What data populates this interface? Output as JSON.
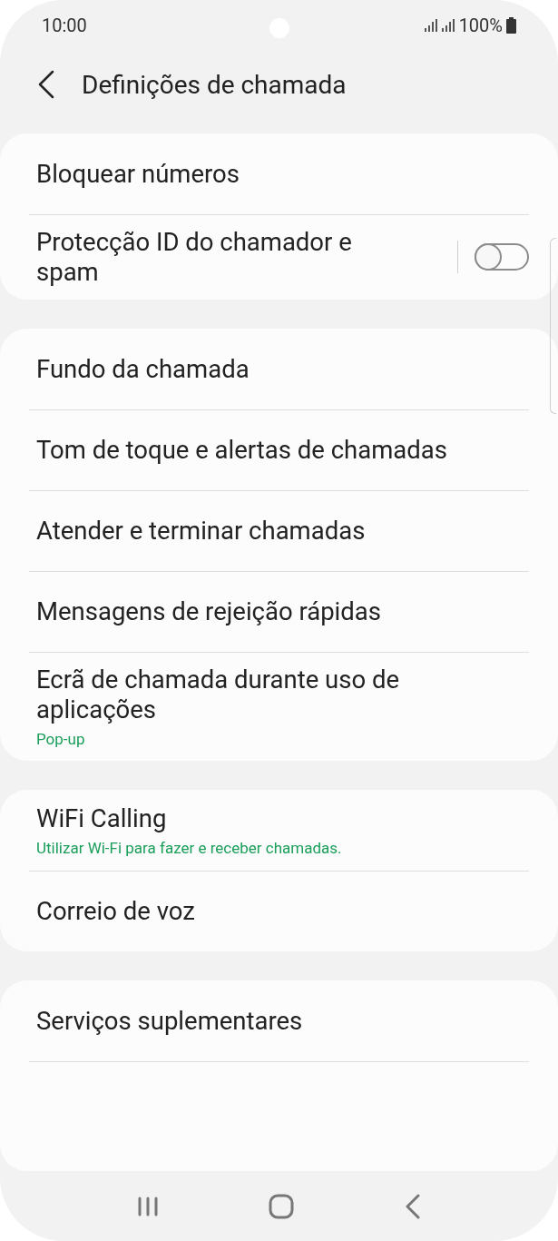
{
  "status_bar": {
    "time": "10:00",
    "battery": "100%"
  },
  "header": {
    "title": "Definições de chamada"
  },
  "sections": [
    {
      "items": [
        {
          "kind": "link",
          "label": "Bloquear números"
        },
        {
          "kind": "toggle",
          "label": "Protecção ID do chamador e spam",
          "on": false
        }
      ]
    },
    {
      "items": [
        {
          "kind": "link",
          "label": "Fundo da chamada"
        },
        {
          "kind": "link",
          "label": "Tom de toque e alertas de chamadas"
        },
        {
          "kind": "link",
          "label": "Atender e terminar chamadas"
        },
        {
          "kind": "link",
          "label": "Mensagens de rejeição rápidas"
        },
        {
          "kind": "link",
          "label": "Ecrã de chamada durante uso de aplicações",
          "summary": "Pop-up"
        }
      ]
    },
    {
      "items": [
        {
          "kind": "link",
          "label": "WiFi Calling",
          "summary": "Utilizar Wi-Fi para fazer e receber chamadas."
        },
        {
          "kind": "link",
          "label": "Correio de voz"
        }
      ]
    },
    {
      "items": [
        {
          "kind": "link",
          "label": "Serviços suplementares"
        }
      ],
      "more_below": true
    }
  ]
}
